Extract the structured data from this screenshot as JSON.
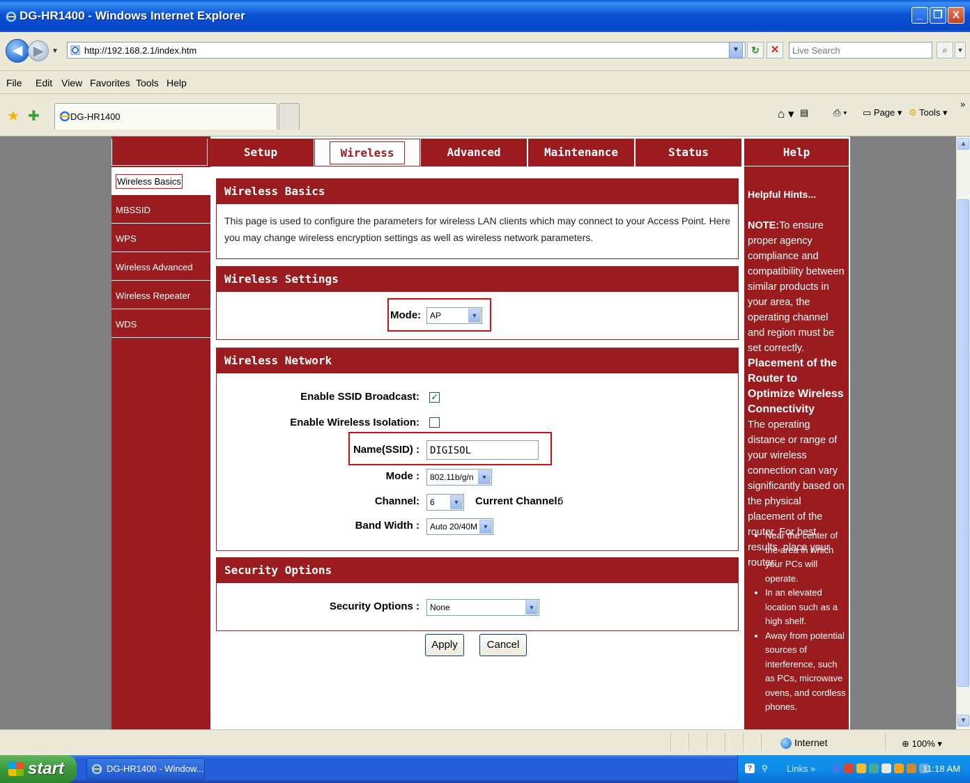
{
  "window": {
    "title": "DG-HR1400 - Windows Internet Explorer",
    "minimize": "_",
    "restore": "❐",
    "close": "X"
  },
  "browser": {
    "url": "http://192.168.2.1/index.htm",
    "search_placeholder": "Live Search",
    "menu": [
      "File",
      "Edit",
      "View",
      "Favorites",
      "Tools",
      "Help"
    ],
    "tab_title": "DG-HR1400",
    "cmd_page": "Page",
    "cmd_tools": "Tools",
    "chevron": "»"
  },
  "router": {
    "top_nav": [
      "Setup",
      "Wireless",
      "Advanced",
      "Maintenance",
      "Status",
      "Help"
    ],
    "active_tab": "Wireless",
    "sidebar": [
      "Wireless Basics",
      "MBSSID",
      "WPS",
      "Wireless Advanced",
      "Wireless Repeater",
      "WDS"
    ],
    "basics": {
      "title": "Wireless Basics",
      "description": "This page is used to configure the parameters for wireless LAN clients which may connect to your Access Point. Here you may change wireless encryption settings as well as wireless network parameters."
    },
    "settings": {
      "title": "Wireless Settings",
      "mode_label": "Mode:",
      "mode_value": "AP"
    },
    "network": {
      "title": "Wireless Network",
      "ssid_broadcast_label": "Enable SSID Broadcast:",
      "ssid_broadcast_checked": true,
      "isolation_label": "Enable Wireless Isolation:",
      "isolation_checked": false,
      "ssid_label": "Name(SSID) :",
      "ssid_value": "DIGISOL",
      "mode_label": "Mode :",
      "mode_value": "802.11b/g/n",
      "channel_label": "Channel:",
      "channel_value": "6",
      "current_channel_label": "Current Channel:",
      "current_channel_value": "6",
      "bandwidth_label": "Band Width :",
      "bandwidth_value": "Auto 20/40M"
    },
    "security": {
      "title": "Security Options",
      "label": "Security Options :",
      "value": "None"
    },
    "buttons": {
      "apply": "Apply",
      "cancel": "Cancel"
    },
    "help": {
      "heading": "Help",
      "hints_title": "Helpful Hints...",
      "note_label": "NOTE:",
      "note_text": "To ensure proper agency compliance and compatibility between similar products in your area, the operating channel and region must be set correctly.",
      "placement_title": "Placement of the Router to Optimize Wireless Connectivity",
      "placement_text": "The operating distance or range of your wireless connection can vary significantly based on the physical placement of the router. For best results, place your router:",
      "tips": [
        "Near the center of the area in which your PCs will operate.",
        "In an elevated location such as a high shelf.",
        "Away from potential sources of interference, such as PCs, microwave ovens, and cordless phones."
      ]
    }
  },
  "statusbar": {
    "zone": "Internet",
    "zoom": "100%"
  },
  "taskbar": {
    "start": "start",
    "task_item": "DG-HR1400 - Window...",
    "links": "Links",
    "clock": "11:18 AM"
  },
  "colors": {
    "router_red": "#9b1c1f",
    "highlight": "#cc1111",
    "xp_blue": "#245edb"
  }
}
